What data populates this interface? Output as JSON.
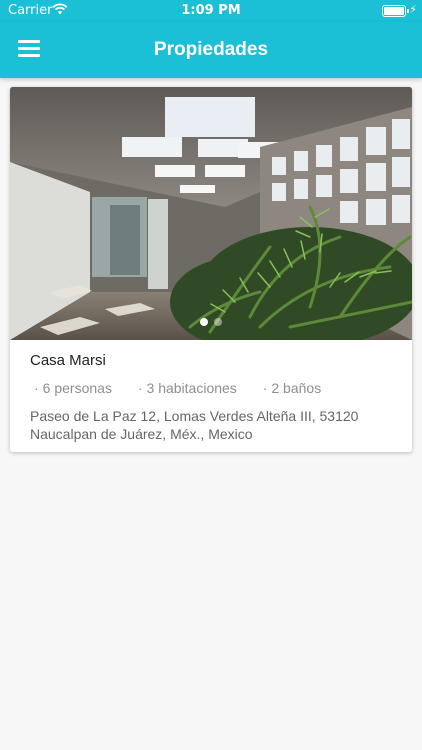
{
  "status_bar": {
    "carrier": "Carrier",
    "time": "1:09 PM",
    "battery_level": 1.0
  },
  "app_bar": {
    "title": "Propiedades",
    "menu_icon": "hamburger-menu-icon"
  },
  "colors": {
    "primary": "#1bbfd6",
    "background": "#f7f7f7",
    "card": "#ffffff"
  },
  "properties": [
    {
      "name": "Casa Marsi",
      "image_count": 2,
      "active_image": 0,
      "features": [
        "6 personas",
        "3 habitaciones",
        "2 baños"
      ],
      "address": "Paseo de La Paz 12, Lomas Verdes Alteña III, 53120 Naucalpan de Juárez, Méx., Mexico"
    }
  ]
}
